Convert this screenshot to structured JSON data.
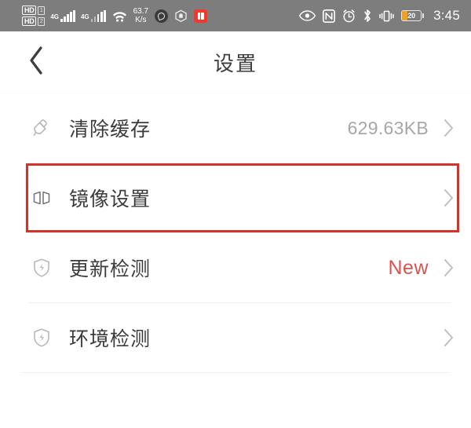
{
  "status_bar": {
    "hd_badge_1": "HD",
    "hd_badge_2": "HD",
    "sim_1": "1",
    "sim_2": "2",
    "net_1": "4G",
    "net_2": "4G",
    "speed_value": "63.7",
    "speed_unit": "K/s",
    "app_icon_1": "browser-icon",
    "app_icon_2": "shield-hexagon-icon",
    "app_icon_3": "book-app-icon",
    "eye_icon": "eye-icon",
    "nfc_icon": "nfc-icon",
    "alarm_icon": "alarm-clock-icon",
    "bluetooth_icon": "bluetooth-icon",
    "vibrate_icon": "vibrate-icon",
    "battery_level": "20",
    "battery_fill_color": "#f2a020",
    "time": "3:45",
    "background_color": "#7d7d7d"
  },
  "header": {
    "back_icon": "chevron-left-icon",
    "title": "设置"
  },
  "list": {
    "items": [
      {
        "icon": "broom-icon",
        "label": "清除缓存",
        "value": "629.63KB",
        "value_color": "#a7a7a7",
        "chevron": "chevron-right-icon",
        "highlighted": false
      },
      {
        "icon": "mirror-icon",
        "label": "镜像设置",
        "value": "",
        "value_color": "",
        "chevron": "chevron-right-icon",
        "highlighted": true
      },
      {
        "icon": "shield-bolt-icon",
        "label": "更新检测",
        "value": "New",
        "value_color": "#d9534f",
        "chevron": "chevron-right-icon",
        "highlighted": false
      },
      {
        "icon": "shield-bolt-icon",
        "label": "环境检测",
        "value": "",
        "value_color": "",
        "chevron": "chevron-right-icon",
        "highlighted": false
      }
    ]
  },
  "theme": {
    "highlight_border_color": "#d2342a",
    "page_background": "#ffffff",
    "divider_color": "#f0f0f0"
  }
}
